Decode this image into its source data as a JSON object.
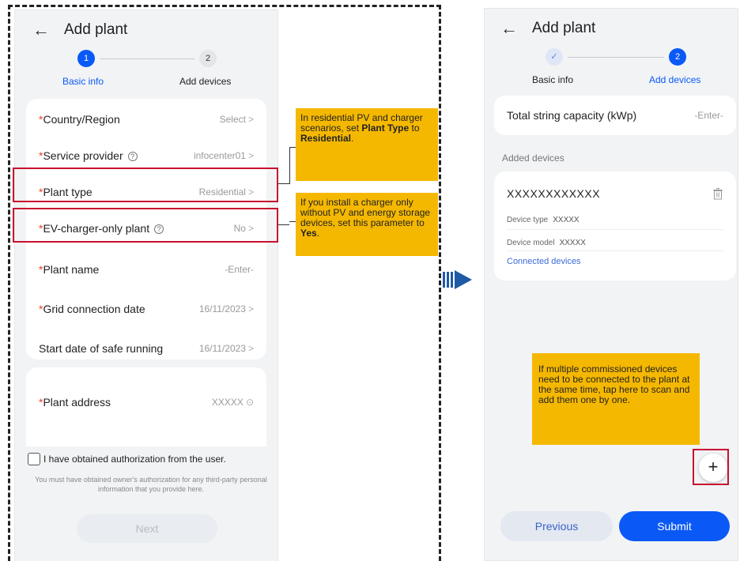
{
  "left_screen": {
    "title": "Add plant",
    "steps": [
      {
        "number": "1",
        "label": "Basic info"
      },
      {
        "number": "2",
        "label": "Add devices"
      }
    ],
    "rows": [
      {
        "label": "Country/Region",
        "value": "Select",
        "required": "*"
      },
      {
        "label": "Service provider",
        "value": "infocenter01",
        "required": "*"
      },
      {
        "label": "Plant type",
        "value": "Residential",
        "required": "*"
      },
      {
        "label": "EV-charger-only plant",
        "value": "No",
        "required": "*"
      },
      {
        "label": "Plant name",
        "value": "-Enter-",
        "required": "*"
      },
      {
        "label": "Grid connection date",
        "value": "16/11/2023",
        "required": "*"
      },
      {
        "label": "Start date of safe running",
        "value": "16/11/2023",
        "required": ""
      }
    ],
    "address": {
      "label": "Plant address",
      "value": "XXXXX",
      "required": "*"
    },
    "checkbox_label": "I have obtained authorization from the user.",
    "note": "You must have obtained owner's authorization for any third-party personal information that you provide here.",
    "next_button": "Next"
  },
  "callouts": {
    "plant_type_1": "In residential PV and charger scenarios, set ",
    "plant_type_b1": "Plant Type",
    "plant_type_2": " to ",
    "plant_type_b2": "Residential",
    "plant_type_3": ".",
    "ev_1": "If you install a charger only without PV and energy storage devices, set this parameter to ",
    "ev_b": "Yes",
    "ev_2": ".",
    "scan": "If multiple commissioned devices need to be connected to the plant at the same time, tap here to scan and add them one by one."
  },
  "right_screen": {
    "title": "Add plant",
    "steps": [
      {
        "number": "✓",
        "label": "Basic info"
      },
      {
        "number": "2",
        "label": "Add devices"
      }
    ],
    "capacity": {
      "label": "Total string capacity (kWp)",
      "value": "-Enter-"
    },
    "added_devices_label": "Added devices",
    "device": {
      "name": "XXXXXXXXXXXX",
      "type_label": "Device type",
      "type_value": "XXXXX",
      "model_label": "Device model",
      "model_value": "XXXXX",
      "connected_link": "Connected devices"
    },
    "plus": "+",
    "previous_button": "Previous",
    "submit_button": "Submit"
  },
  "colors": {
    "accent": "#0a59f7",
    "callout": "#f5b800",
    "highlight": "#c8102e"
  }
}
